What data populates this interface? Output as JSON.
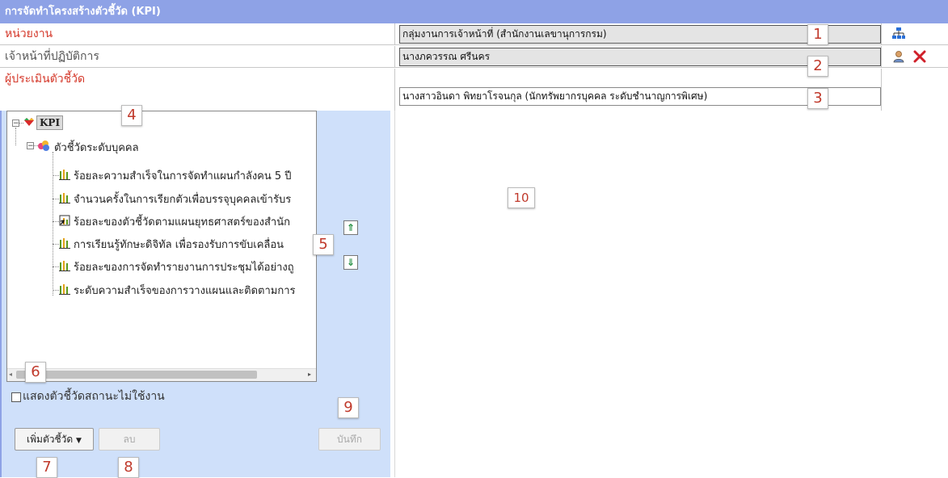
{
  "title": "การจัดทำโครงสร้างตัวชี้วัด (KPI)",
  "rows": {
    "unit": {
      "label": "หน่วยงาน",
      "value": "กลุ่มงานการเจ้าหน้าที่ (สำนักงานเลขานุการกรม)"
    },
    "officer": {
      "label": "เจ้าหน้าที่ปฏิบัติการ",
      "value": "นางภควรรณ ศรีนคร"
    },
    "evaluator": {
      "label": "ผู้ประเมินตัวชี้วัด",
      "value": "นางสาวอินดา พิทยาโรจนกุล (นักทรัพยากรบุคคล ระดับชำนาญการพิเศษ)"
    }
  },
  "tree": {
    "root": {
      "label": "KPI",
      "expander": "⊟"
    },
    "group": {
      "label": "ตัวชี้วัดระดับบุคคล",
      "expander": "⊟"
    },
    "items": [
      {
        "label": "ร้อยละความสำเร็จในการจัดทำแผนกำลังคน 5 ปี",
        "icon": "bar-chart-icon"
      },
      {
        "label": "จำนวนครั้งในการเรียกตัวเพื่อบรรจุบุคคลเข้ารับร",
        "icon": "bar-chart-icon"
      },
      {
        "label": "ร้อยละของตัวชี้วัดตามแผนยุทธศาสตร์ของสำนัก",
        "icon": "linked-doc-icon"
      },
      {
        "label": "การเรียนรู้ทักษะดิจิทัล เพื่อรองรับการขับเคลื่อน",
        "icon": "bar-chart-icon"
      },
      {
        "label": "ร้อยละของการจัดทำรายงานการประชุมได้อย่างถู",
        "icon": "bar-chart-icon"
      },
      {
        "label": "ระดับความสำเร็จของการวางแผนและติดตามการ",
        "icon": "bar-chart-icon"
      }
    ]
  },
  "show_inactive_label": "แสดงตัวชี้วัดสถานะไม่ใช้งาน",
  "buttons": {
    "add": "เพิ่มตัวชี้วัด",
    "delete": "ลบ",
    "save": "บันทึก"
  },
  "arrows": {
    "up": "⇑",
    "down": "⇓"
  },
  "annotations": [
    "1",
    "2",
    "3",
    "4",
    "5",
    "6",
    "7",
    "8",
    "9",
    "10"
  ],
  "icons": {
    "org_chart": "org-chart-icon",
    "user": "user-icon",
    "remove": "close-icon"
  },
  "colors": {
    "header_bg": "#8ea2e6",
    "panel_bg": "#cfe0fa",
    "label_red": "#d53a2c",
    "marker_red": "#c0392b"
  }
}
